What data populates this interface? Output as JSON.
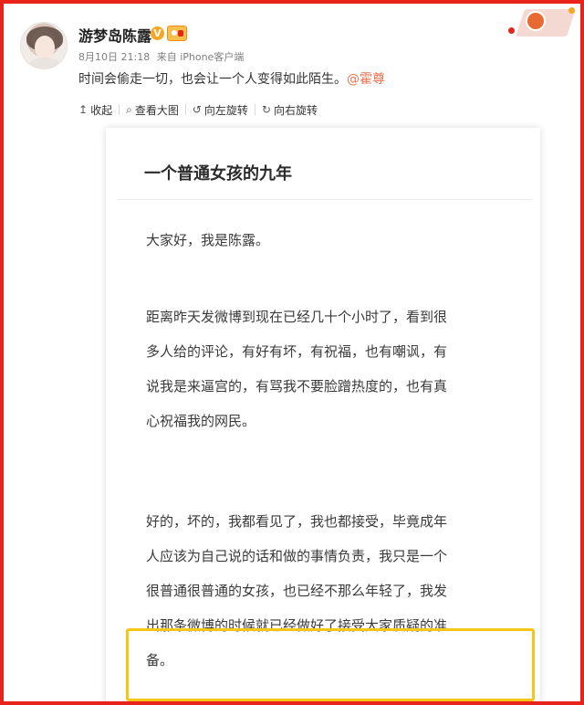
{
  "post": {
    "username": "游梦岛陈露",
    "verified_badge": "V",
    "time": "8月10日 21:18",
    "source": "来自 iPhone客户端",
    "text": "时间会偷走一切，也会让一个人变得如此陌生。",
    "mention": "@霍尊"
  },
  "toolbar": {
    "items": [
      {
        "icon": "collapse-icon",
        "glyph": "↥",
        "label": "收起"
      },
      {
        "icon": "zoom-icon",
        "glyph": "⌕",
        "label": "查看大图"
      },
      {
        "icon": "rotate-left-icon",
        "glyph": "↺",
        "label": "向左旋转"
      },
      {
        "icon": "rotate-right-icon",
        "glyph": "↻",
        "label": "向右旋转"
      }
    ]
  },
  "image": {
    "title": "一个普通女孩的九年",
    "paragraphs": [
      [
        "大家好，我是陈露。"
      ],
      [
        "距离昨天发微博到现在已经几十个小时了，看到很",
        "多人给的评论，有好有坏，有祝福，也有嘲讽，有",
        "说我是来逼宫的，有骂我不要脸蹭热度的，也有真",
        "心祝福我的网民。"
      ],
      [
        "好的，坏的，我都看见了，我也都接受，毕竟成年",
        "人应该为自己说的话和做的事情负责，我只是一个",
        "很普通很普通的女孩，也已经不那么年轻了，我发",
        "出那条微博的时候就已经做好了接受大家质疑的准",
        "备。"
      ]
    ]
  },
  "colors": {
    "frame": "#e8231c",
    "highlight": "#f5c518",
    "mention": "#eb7350"
  }
}
